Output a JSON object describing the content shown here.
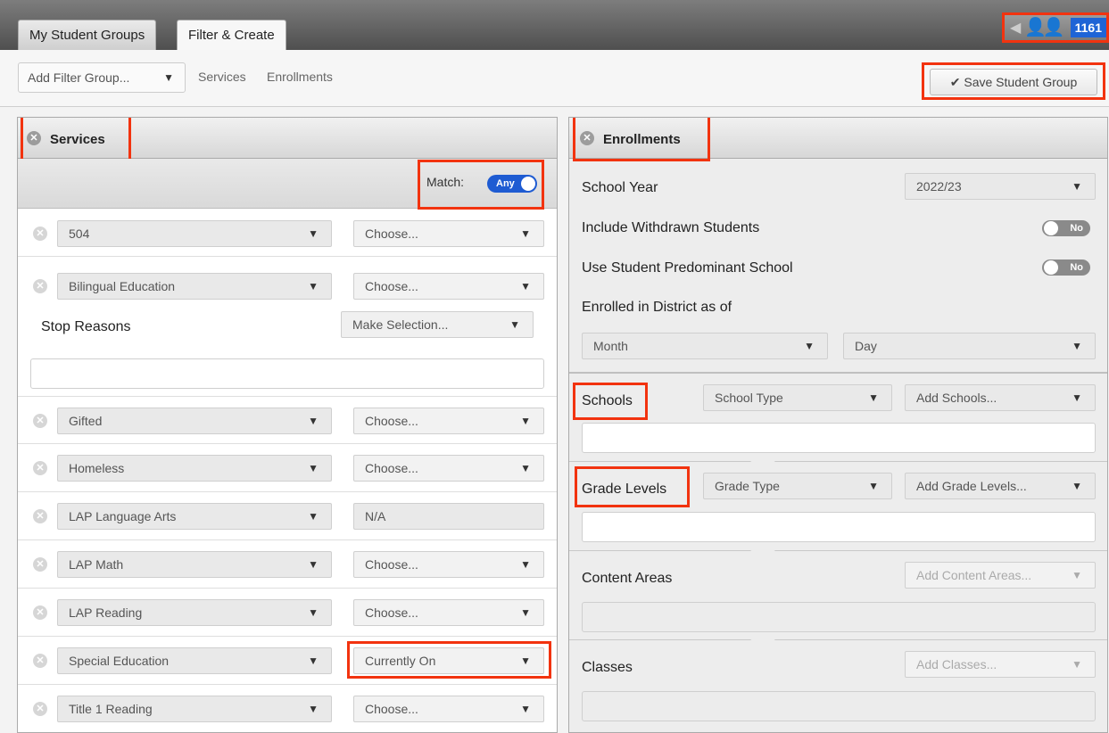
{
  "tabs": [
    {
      "label": "My Student Groups"
    },
    {
      "label": "Filter & Create"
    }
  ],
  "student_count": "1161",
  "toolbar": {
    "add_filter_label": "Add Filter Group...",
    "links": [
      "Services",
      "Enrollments"
    ],
    "save_label": "Save Student Group"
  },
  "services": {
    "title": "Services",
    "match_label": "Match:",
    "match_value": "Any",
    "rows": [
      {
        "service": "504",
        "status": "Choose..."
      },
      {
        "service": "Bilingual Education",
        "status": "Choose..."
      },
      {
        "service": "Gifted",
        "status": "Choose..."
      },
      {
        "service": "Homeless",
        "status": "Choose..."
      },
      {
        "service": "LAP Language Arts",
        "status": "N/A"
      },
      {
        "service": "LAP Math",
        "status": "Choose..."
      },
      {
        "service": "LAP Reading",
        "status": "Choose..."
      },
      {
        "service": "Special Education",
        "status": "Currently On"
      },
      {
        "service": "Title 1 Reading",
        "status": "Choose..."
      }
    ],
    "stop_reasons_label": "Stop Reasons",
    "stop_reasons_select": "Make Selection..."
  },
  "enrollments": {
    "title": "Enrollments",
    "school_year_label": "School Year",
    "school_year_value": "2022/23",
    "withdrawn_label": "Include Withdrawn Students",
    "withdrawn_value": "No",
    "predominant_label": "Use Student Predominant School",
    "predominant_value": "No",
    "enrolled_label": "Enrolled in District as of",
    "month_placeholder": "Month",
    "day_placeholder": "Day",
    "schools_label": "Schools",
    "school_type": "School Type",
    "add_schools": "Add Schools...",
    "grade_levels_label": "Grade Levels",
    "grade_type": "Grade Type",
    "add_grade_levels": "Add Grade Levels...",
    "content_areas_label": "Content Areas",
    "add_content_areas": "Add Content Areas...",
    "classes_label": "Classes",
    "add_classes": "Add Classes..."
  }
}
